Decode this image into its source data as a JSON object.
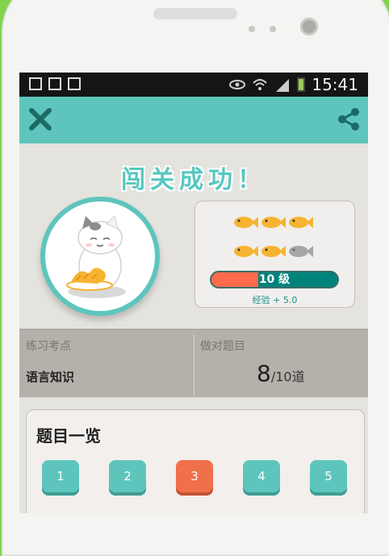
{
  "status_bar": {
    "time": "15:41"
  },
  "action_bar": {
    "close_icon": "close-icon",
    "share_icon": "share-icon"
  },
  "result": {
    "title": "闯关成功！",
    "fish_row1": [
      "gold",
      "gold",
      "gold"
    ],
    "fish_row2": [
      "gold",
      "gold",
      "gray"
    ],
    "level_label": "10 级",
    "level_progress": 0.37,
    "exp_text": "经验 + 5.0"
  },
  "stats": {
    "practice_label": "练习考点",
    "practice_value": "语言知识",
    "correct_label": "做对题目",
    "correct_count": "8",
    "correct_total": "/10道"
  },
  "questions": {
    "title": "题目一览",
    "items": [
      {
        "label": "1",
        "state": "ok"
      },
      {
        "label": "2",
        "state": "ok"
      },
      {
        "label": "3",
        "state": "bad"
      },
      {
        "label": "4",
        "state": "ok"
      },
      {
        "label": "5",
        "state": "ok"
      }
    ]
  },
  "colors": {
    "accent": "#5ec5bd",
    "wrong": "#f0704c",
    "fish_gold": "#f6b431",
    "fish_gray": "#a6a6a6"
  }
}
